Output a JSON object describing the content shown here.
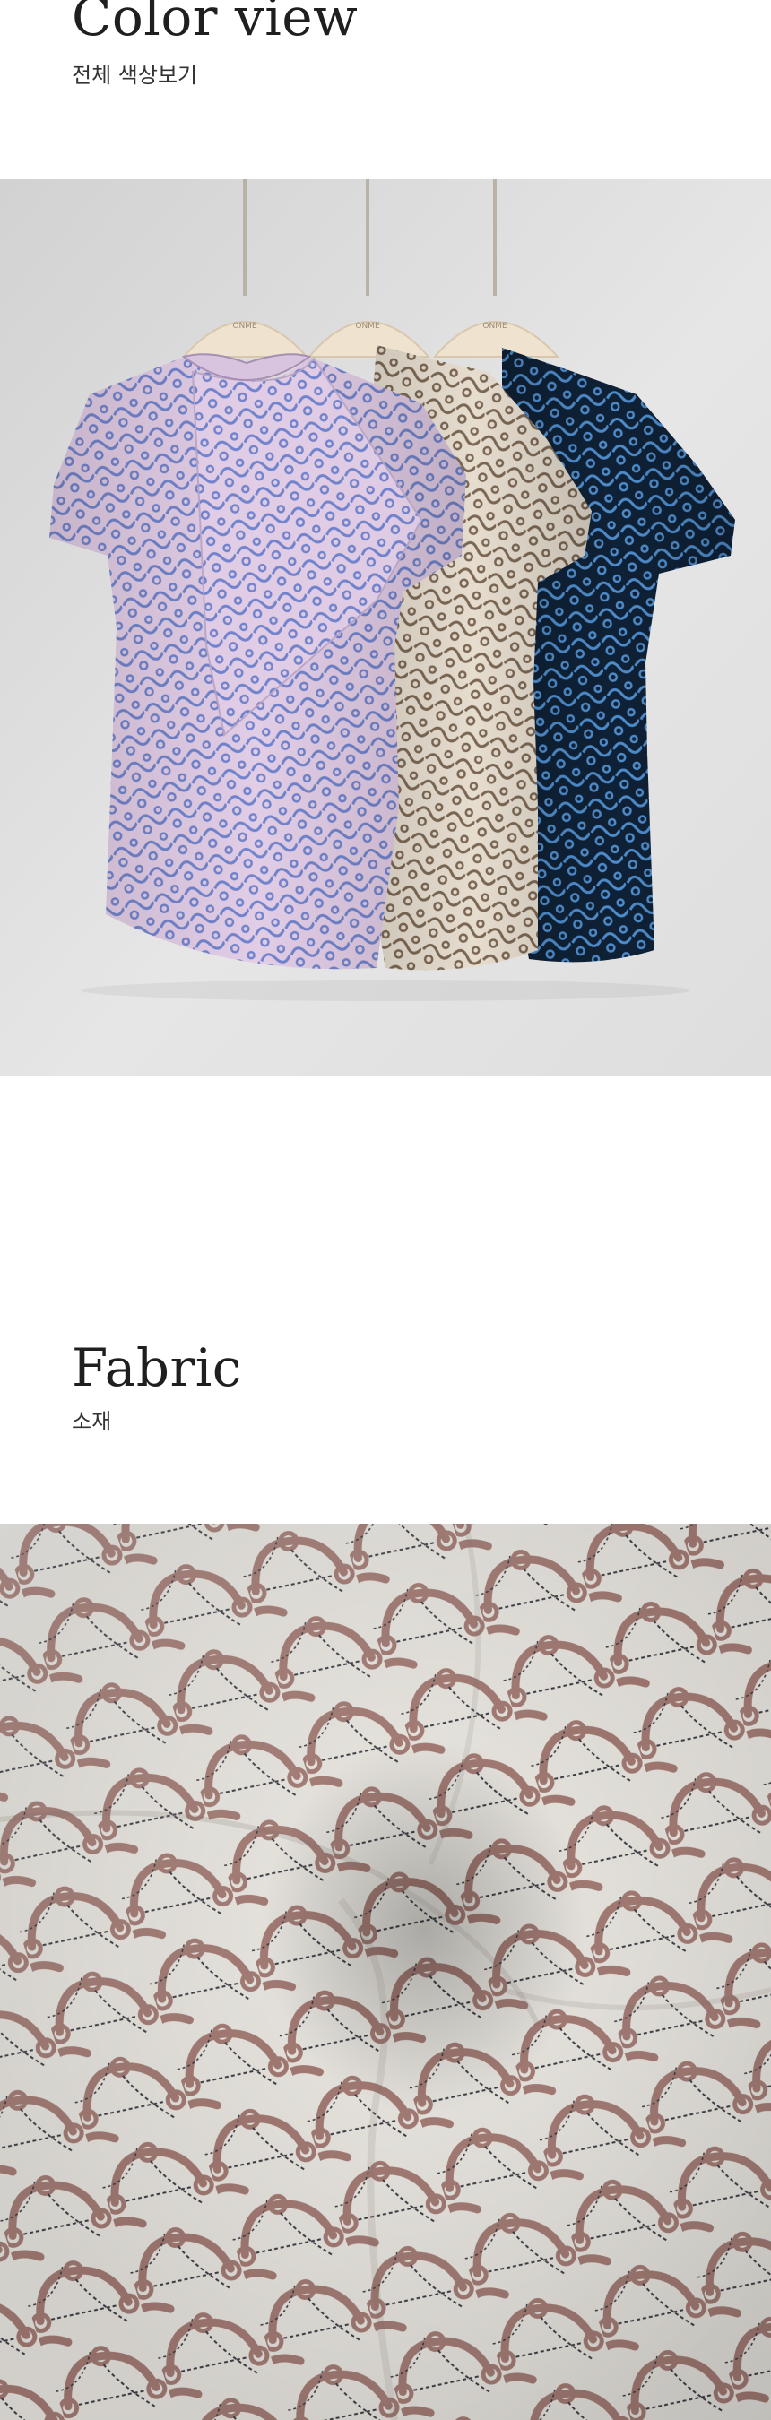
{
  "color_view": {
    "title": "Color view",
    "subtitle": "전체 색상보기",
    "hanger_brand": "ONME",
    "garments": [
      {
        "color_name": "lavender",
        "base": "#d8c3df",
        "pattern": "#6c7fc8"
      },
      {
        "color_name": "beige",
        "base": "#e2d8c9",
        "pattern": "#7e6a55"
      },
      {
        "color_name": "navy",
        "base": "#102238",
        "pattern": "#4a86c2"
      }
    ]
  },
  "fabric": {
    "title": "Fabric",
    "subtitle": "소재",
    "base": "#ece9e3",
    "chain": "#a77e78",
    "rope": "#3c3c44"
  }
}
